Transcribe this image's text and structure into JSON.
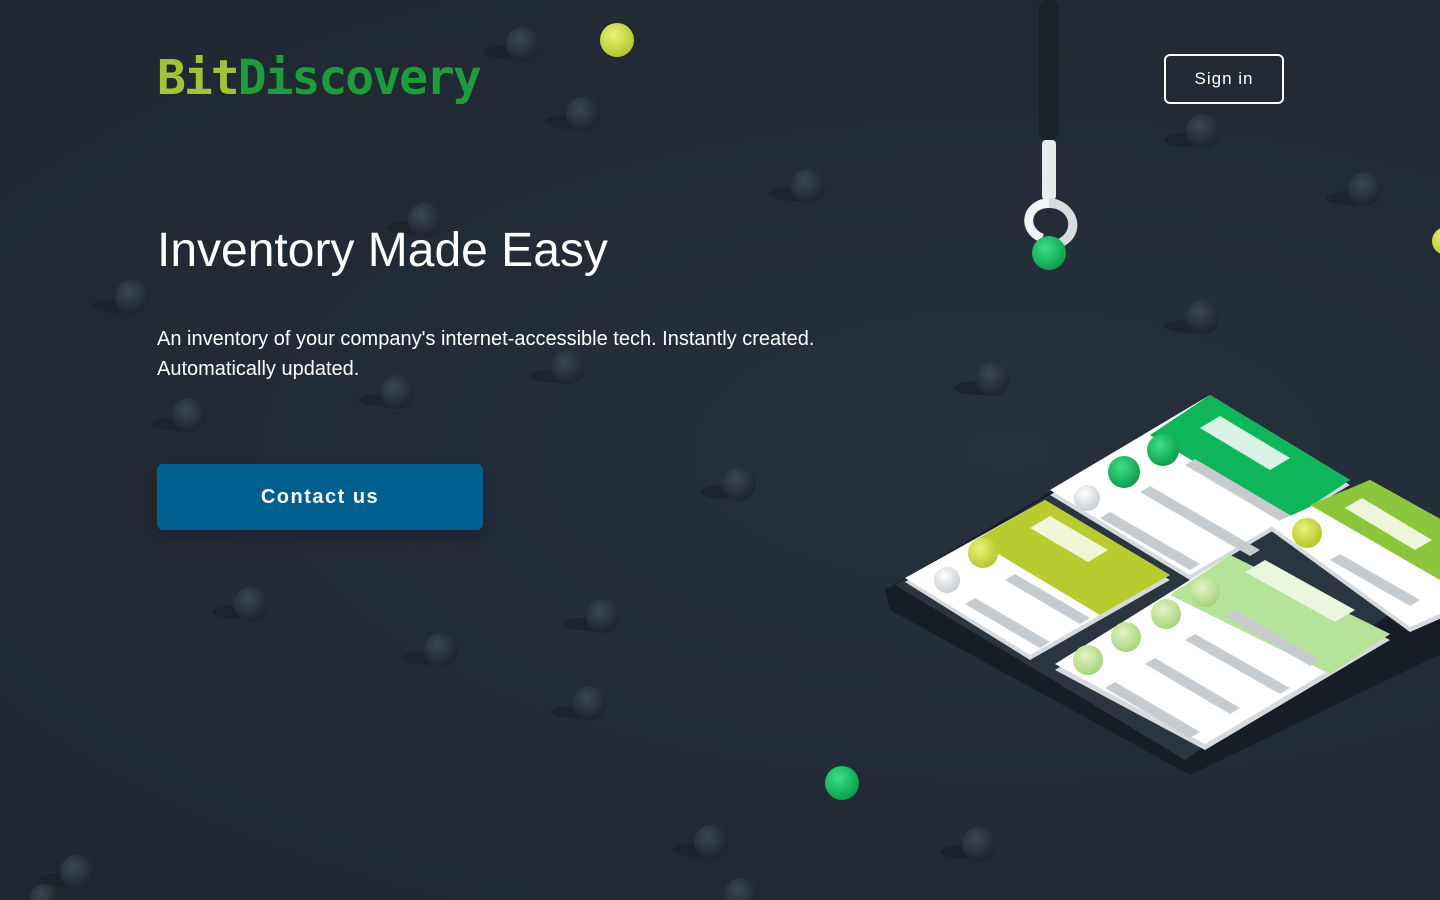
{
  "header": {
    "logo_part1": "Bit",
    "logo_part2": "Discovery",
    "sign_in_label": "Sign in"
  },
  "hero": {
    "title": "Inventory Made Easy",
    "subtitle_line1": "An inventory of your company's internet-accessible tech. Instantly created.",
    "subtitle_line2": "Automatically updated.",
    "cta_label": "Contact us"
  },
  "colors": {
    "background": "#222c36",
    "logo_bit": "#a3c23a",
    "logo_discovery": "#1e9c3c",
    "cta_background": "#005f8f",
    "accent_green": "#17b35a",
    "accent_lime": "#b9d23c"
  },
  "illustration": {
    "description_icon": "inventory-board-illustration"
  }
}
